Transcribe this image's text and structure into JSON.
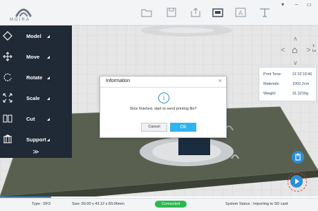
{
  "app": {
    "logo_text": "MOIRA"
  },
  "toolbar": {
    "tools": [
      {
        "icon": "folder-icon"
      },
      {
        "icon": "save-icon"
      },
      {
        "icon": "export-icon"
      },
      {
        "icon": "print-icon"
      },
      {
        "icon": "text-icon"
      },
      {
        "icon": "support-icon"
      }
    ]
  },
  "window_controls": {
    "menu": "▾",
    "minimize": "–",
    "maximize": "▭"
  },
  "sidebar": {
    "items": [
      {
        "label": "Model",
        "icon": "model-icon"
      },
      {
        "label": "Move",
        "icon": "move-icon"
      },
      {
        "label": "Rotate",
        "icon": "rotate-icon"
      },
      {
        "label": "Scale",
        "icon": "scale-icon"
      },
      {
        "label": "Cut",
        "icon": "cut-icon"
      },
      {
        "label": "Support",
        "icon": "support-icon"
      }
    ],
    "more": "≫"
  },
  "view_nav": {
    "up": "∧",
    "left": "<",
    "home": "⌂",
    "right": ">",
    "down": "∨",
    "side_label_top": "1:",
    "side_label_bottom": "Lε"
  },
  "print_info": {
    "rows": [
      {
        "key": "Print Time:",
        "value": "21’22’15’46"
      },
      {
        "key": "Materials:",
        "value": "1002.2cm"
      },
      {
        "key": "Weight:",
        "value": "31.3216g"
      }
    ]
  },
  "dialog": {
    "title": "Information",
    "close": "×",
    "message": "Slice finished, start to send printing file?",
    "cancel_label": "Cancel",
    "ok_label": "Ok"
  },
  "status": {
    "type": "Type : DF3",
    "size": "Size: 50.00 x 43.12 x 83.06mm",
    "connection": "Connected",
    "system_status": "System Status : Importing to SD card"
  },
  "colors": {
    "accent": "#2b8fd6",
    "ok": "#2fb4f0",
    "connected": "#2db84d",
    "sidebar": "#1f2a36"
  }
}
